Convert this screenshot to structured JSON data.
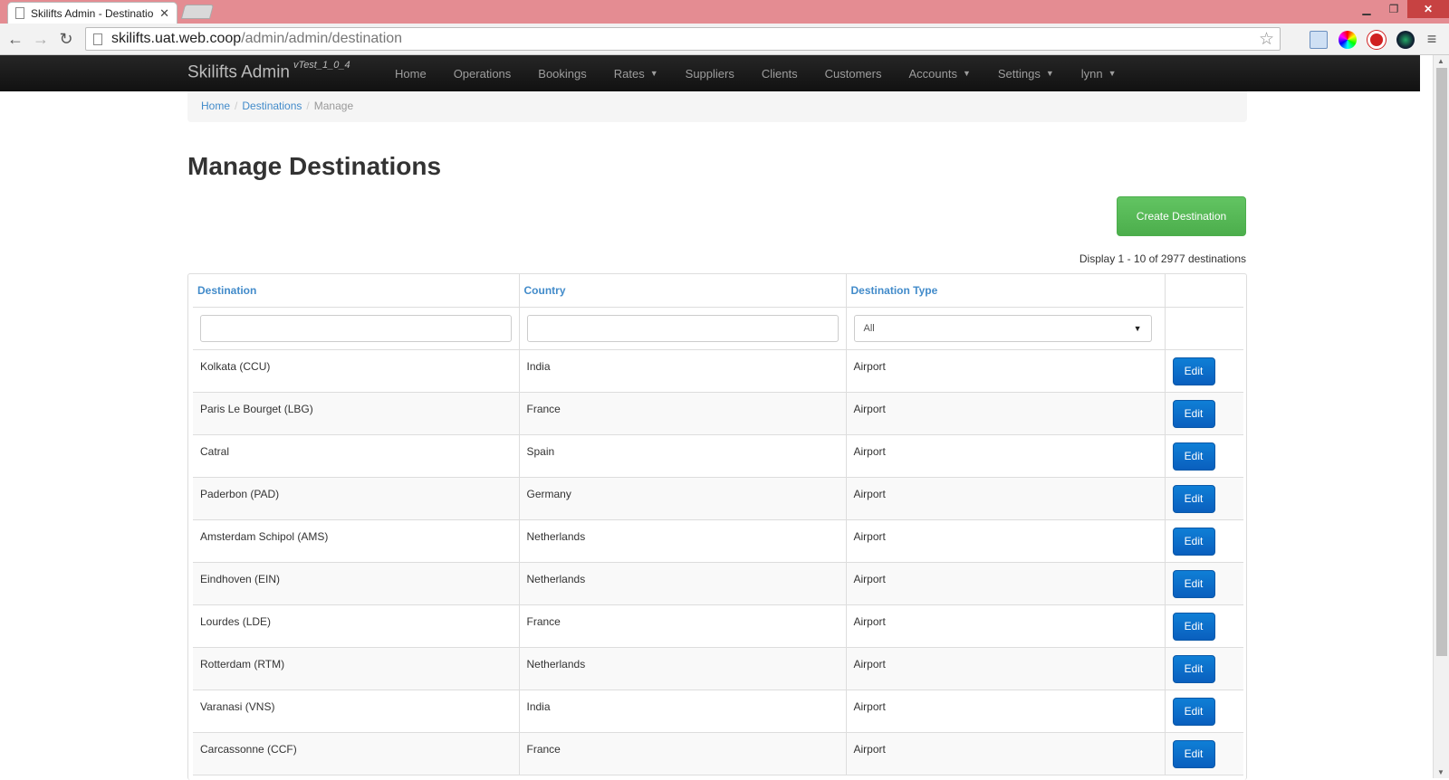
{
  "browser": {
    "tab_title": "Skilifts Admin - Destinatio",
    "tab_close": "✕",
    "url_host": "skilifts.uat.web.coop",
    "url_path": "/admin/admin/destination"
  },
  "nav": {
    "brand": "Skilifts Admin",
    "version": "vTest_1_0_4",
    "items": [
      {
        "label": "Home",
        "dropdown": false
      },
      {
        "label": "Operations",
        "dropdown": false
      },
      {
        "label": "Bookings",
        "dropdown": false
      },
      {
        "label": "Rates",
        "dropdown": true
      },
      {
        "label": "Suppliers",
        "dropdown": false
      },
      {
        "label": "Clients",
        "dropdown": false
      },
      {
        "label": "Customers",
        "dropdown": false
      },
      {
        "label": "Accounts",
        "dropdown": true
      },
      {
        "label": "Settings",
        "dropdown": true
      },
      {
        "label": "lynn",
        "dropdown": true
      }
    ]
  },
  "breadcrumb": {
    "home": "Home",
    "destinations": "Destinations",
    "current": "Manage",
    "separator": "/"
  },
  "page": {
    "title": "Manage Destinations",
    "create_button": "Create Destination",
    "display_count": "Display 1 - 10 of 2977 destinations"
  },
  "table": {
    "columns": [
      "Destination",
      "Country",
      "Destination Type"
    ],
    "filters": {
      "destination": "",
      "country": "",
      "type_selected": "All"
    },
    "edit_label": "Edit",
    "rows": [
      {
        "destination": "Kolkata (CCU)",
        "country": "India",
        "type": "Airport"
      },
      {
        "destination": "Paris Le Bourget (LBG)",
        "country": "France",
        "type": "Airport"
      },
      {
        "destination": "Catral",
        "country": "Spain",
        "type": "Airport"
      },
      {
        "destination": "Paderbon (PAD)",
        "country": "Germany",
        "type": "Airport"
      },
      {
        "destination": "Amsterdam Schipol (AMS)",
        "country": "Netherlands",
        "type": "Airport"
      },
      {
        "destination": "Eindhoven (EIN)",
        "country": "Netherlands",
        "type": "Airport"
      },
      {
        "destination": "Lourdes (LDE)",
        "country": "France",
        "type": "Airport"
      },
      {
        "destination": "Rotterdam (RTM)",
        "country": "Netherlands",
        "type": "Airport"
      },
      {
        "destination": "Varanasi (VNS)",
        "country": "India",
        "type": "Airport"
      },
      {
        "destination": "Carcassonne (CCF)",
        "country": "France",
        "type": "Airport"
      }
    ]
  },
  "colors": {
    "link": "#428bca",
    "create_button": "#5cb85c",
    "edit_button": "#0d6fcc",
    "navbar": "#1b1b1b",
    "titlebar": "#e48c92"
  }
}
